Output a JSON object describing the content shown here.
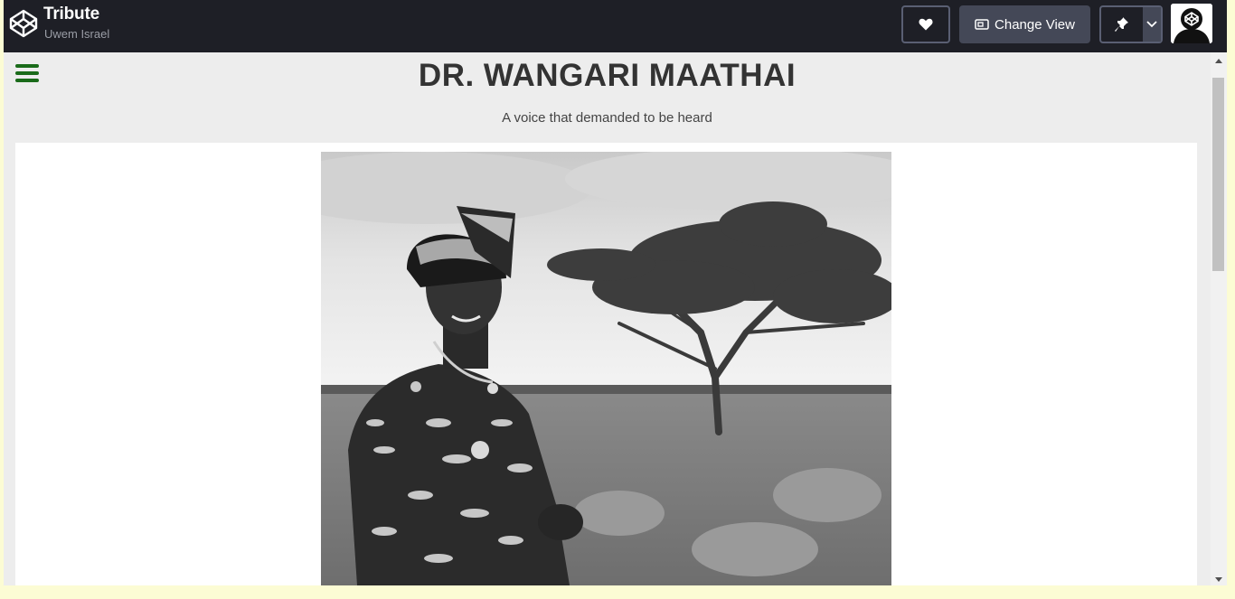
{
  "header": {
    "pen_title": "Tribute",
    "author": "Uwem Israel",
    "change_view_label": "Change View",
    "icons": [
      "codepen-logo-icon",
      "heart-icon",
      "change-view-icon",
      "pin-icon",
      "chevron-down-icon",
      "user-avatar"
    ]
  },
  "page": {
    "title": "DR. WANGARI MAATHAI",
    "subtitle": "A voice that demanded to be heard",
    "menu_icon": "hamburger-menu-icon",
    "accent_color": "#1a6b1a"
  },
  "colors": {
    "topbar": "#1e1f26",
    "button": "#444857",
    "page_bg": "#ededed",
    "card_bg": "#ffffff"
  }
}
